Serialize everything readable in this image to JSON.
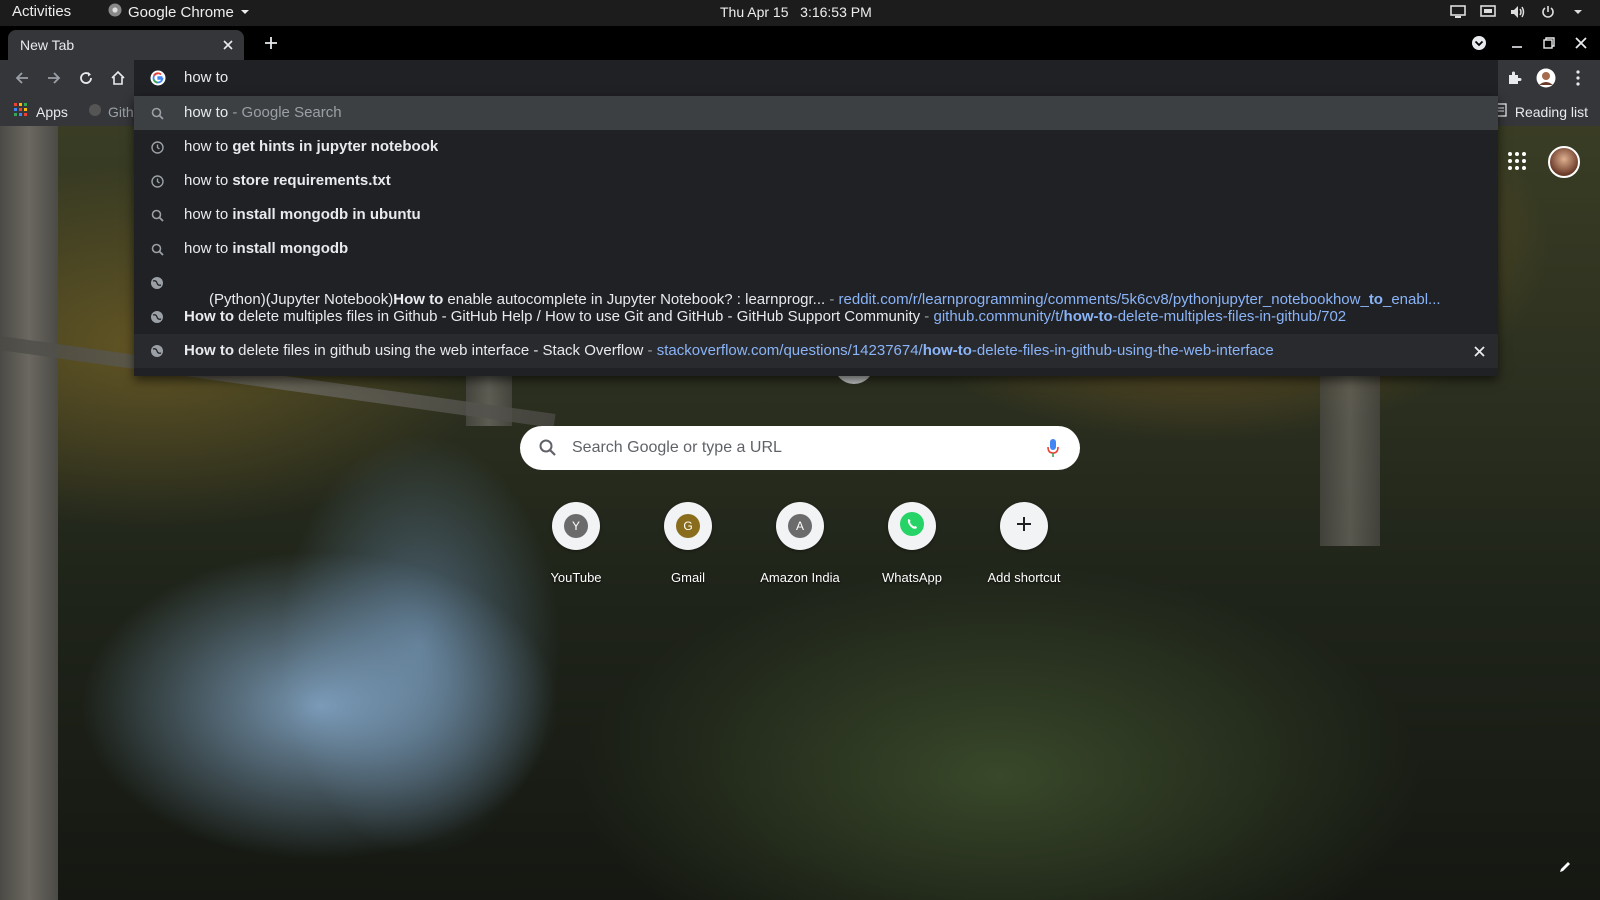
{
  "system_bar": {
    "activities": "Activities",
    "app_name": "Google Chrome",
    "datetime": "Thu Apr 15   3:16:53 PM"
  },
  "browser": {
    "tab_title": "New Tab",
    "omnibox_text": "how to",
    "bookmarks": {
      "apps_label": "Apps",
      "github_label": "Gith",
      "reading_list_label": "Reading list"
    }
  },
  "suggestions": [
    {
      "type": "search",
      "icon": "search-icon",
      "prefix": "how to",
      "suffix": " - Google Search"
    },
    {
      "type": "history",
      "icon": "history-clock-icon",
      "prefix": "how to ",
      "bold": "get hints in jupyter notebook"
    },
    {
      "type": "history",
      "icon": "history-clock-icon",
      "prefix": "how to ",
      "bold": "store requirements.txt"
    },
    {
      "type": "search",
      "icon": "search-icon",
      "prefix": "how to ",
      "bold": "install mongodb in ubuntu"
    },
    {
      "type": "search",
      "icon": "search-icon",
      "prefix": "how to ",
      "bold": "install mongodb"
    },
    {
      "type": "url",
      "icon": "globe-icon",
      "title_pre": "(Python)(Jupyter Notebook)",
      "title_bold": "How to",
      "title_post": " enable autocomplete in Jupyter Notebook? : learnprogr...",
      "sep": " - ",
      "url_pre": "reddit.com/r/learnprogramming/comments/5k6cv8/pythonjupyter_notebookhow_",
      "url_bold": "to",
      "url_post": "_enabl..."
    },
    {
      "type": "url",
      "icon": "globe-icon",
      "title_pre": "",
      "title_bold": "How to",
      "title_post": " delete multiples files in Github - GitHub Help / How to use Git and GitHub - GitHub Support Community",
      "sep": " - ",
      "url_pre": "github.community/t/",
      "url_bold": "how-to",
      "url_post": "-delete-multiples-files-in-github/702"
    },
    {
      "type": "url",
      "icon": "globe-icon",
      "title_pre": "",
      "title_bold": "How to",
      "title_post": " delete files in github using the web interface - Stack Overflow",
      "sep": " - ",
      "url_pre": "stackoverflow.com/questions/14237674/",
      "url_bold": "how-to",
      "url_post": "-delete-files-in-github-using-the-web-interface"
    }
  ],
  "ntp": {
    "search_placeholder": "Search Google or type a URL",
    "shortcuts": [
      {
        "label": "YouTube",
        "letter": "Y",
        "color": "#6b6b6b"
      },
      {
        "label": "Gmail",
        "letter": "G",
        "color": "#8a6d1c"
      },
      {
        "label": "Amazon India",
        "letter": "A",
        "color": "#6b6b6b"
      },
      {
        "label": "WhatsApp",
        "letter": "",
        "color": "#25d366"
      },
      {
        "label": "Add shortcut",
        "letter": "+",
        "color": ""
      }
    ]
  },
  "colors": {
    "url_blue": "#8ab4f8",
    "omnibox_bg": "#202124",
    "toolbar_bg": "#35363a",
    "selected_row": "#3c4043"
  }
}
